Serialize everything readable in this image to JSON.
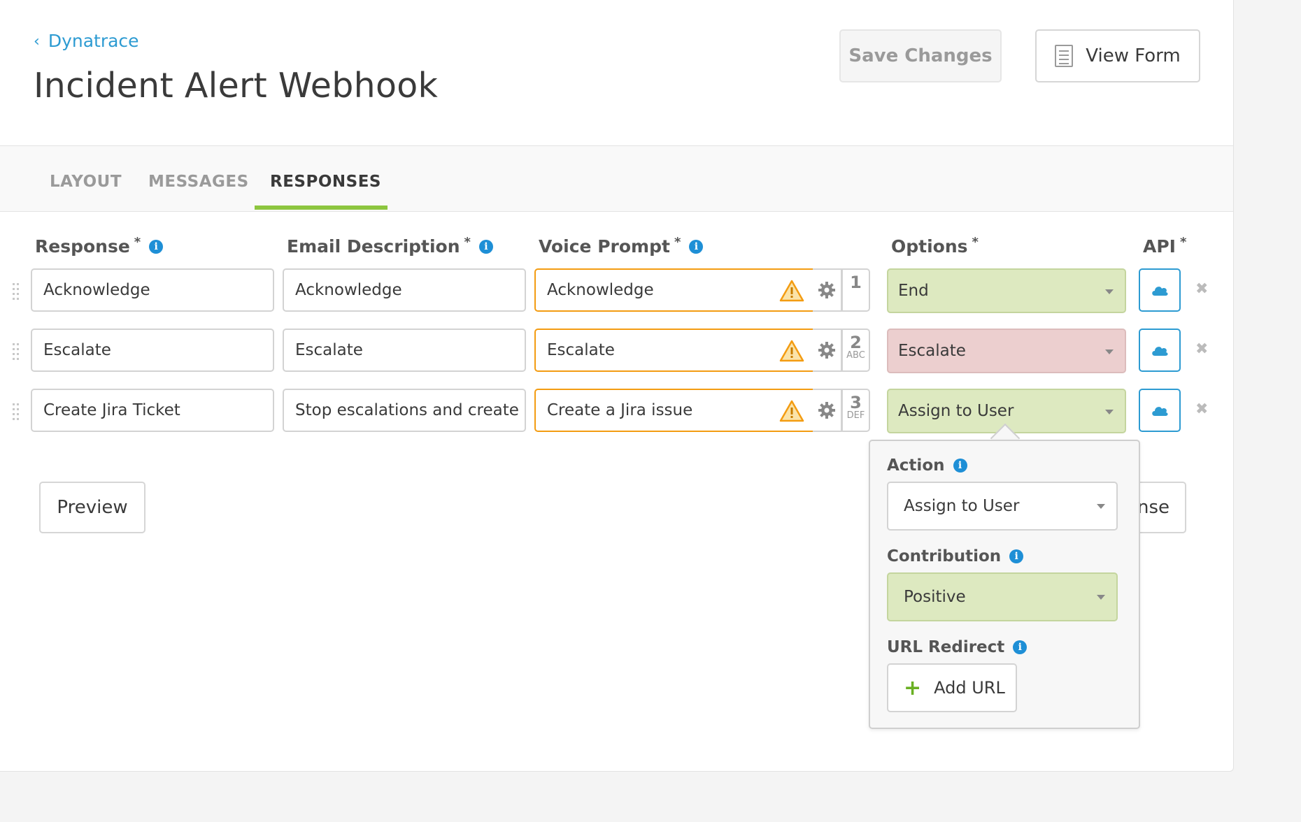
{
  "header": {
    "back_label": "Dynatrace",
    "title": "Incident Alert Webhook",
    "save_label": "Save Changes",
    "view_form_label": "View Form"
  },
  "tabs": [
    {
      "label": "LAYOUT",
      "active": false
    },
    {
      "label": "MESSAGES",
      "active": false
    },
    {
      "label": "RESPONSES",
      "active": true
    }
  ],
  "columns": {
    "response": "Response",
    "email": "Email Description",
    "voice": "Voice Prompt",
    "options": "Options",
    "api": "API",
    "required_mark": "*"
  },
  "rows": [
    {
      "response": "Acknowledge",
      "email": "Acknowledge",
      "voice": "Acknowledge",
      "key_number": "1",
      "key_letters": "",
      "option": "End",
      "option_color": "green"
    },
    {
      "response": "Escalate",
      "email": "Escalate",
      "voice": "Escalate",
      "key_number": "2",
      "key_letters": "ABC",
      "option": "Escalate",
      "option_color": "red"
    },
    {
      "response": "Create Jira Ticket",
      "email": "Stop escalations and create",
      "voice": "Create a Jira issue",
      "key_number": "3",
      "key_letters": "DEF",
      "option": "Assign to User",
      "option_color": "green"
    }
  ],
  "footer": {
    "preview_label": "Preview",
    "add_response_label_visible": "nse"
  },
  "popover": {
    "action_label": "Action",
    "action_value": "Assign to User",
    "contribution_label": "Contribution",
    "contribution_value": "Positive",
    "url_redirect_label": "URL Redirect",
    "add_url_label": "Add URL"
  },
  "colors": {
    "accent": "#2d9bd2",
    "tab_active_underline": "#8dc63f",
    "warning": "#f39c12",
    "option_green": "#dde9c0",
    "option_red": "#eccfcf"
  },
  "icons": {
    "info": "info-icon",
    "warning": "warning-triangle-icon",
    "settings": "gear-icon",
    "api": "cloud-icon",
    "remove": "close-icon",
    "drag": "drag-handle-icon",
    "form": "document-icon",
    "add": "plus-icon"
  }
}
